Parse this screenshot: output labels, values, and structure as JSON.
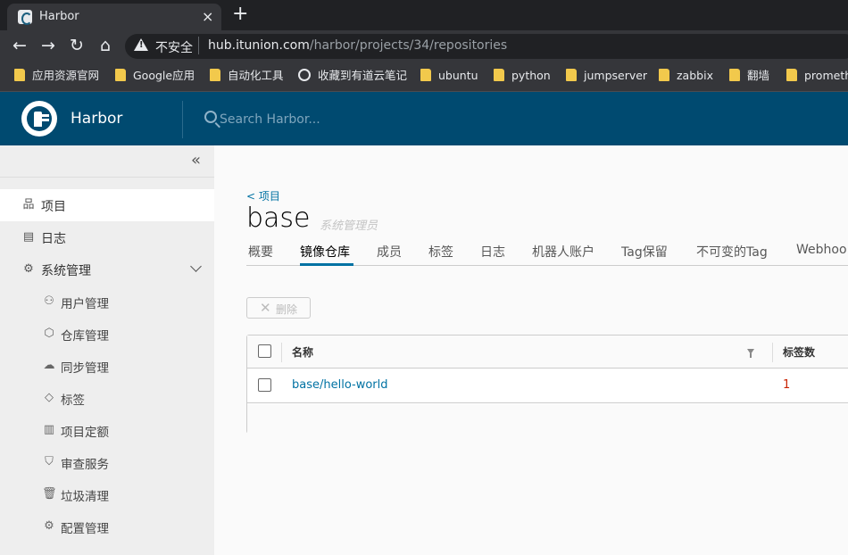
{
  "browser": {
    "tab_title": "Harbor",
    "close_glyph": "×",
    "new_tab_glyph": "+",
    "insecure_label": "不安全",
    "url_host": "hub.itunion.com",
    "url_path": "/harbor/projects/34/repositories",
    "back_glyph": "←",
    "forward_glyph": "→",
    "reload_glyph": "↻",
    "home_glyph": "⌂",
    "bookmarks": [
      {
        "label": "应用资源官网",
        "icon": "folder-icon"
      },
      {
        "label": "Google应用",
        "icon": "folder-icon"
      },
      {
        "label": "自动化工具",
        "icon": "folder-icon"
      },
      {
        "label": "收藏到有道云笔记",
        "icon": "globe-icon"
      },
      {
        "label": "ubuntu",
        "icon": "folder-icon"
      },
      {
        "label": "python",
        "icon": "folder-icon"
      },
      {
        "label": "jumpserver",
        "icon": "folder-icon"
      },
      {
        "label": "zabbix",
        "icon": "folder-icon"
      },
      {
        "label": "翻墙",
        "icon": "folder-icon"
      },
      {
        "label": "prometh",
        "icon": "folder-icon"
      }
    ]
  },
  "header": {
    "brand": "Harbor",
    "search_placeholder": "Search Harbor..."
  },
  "sidebar": {
    "collapse_glyph": "«",
    "items": [
      {
        "label": "项目",
        "icon": "projects-icon",
        "glyph": "品",
        "active": true
      },
      {
        "label": "日志",
        "icon": "logs-icon",
        "glyph": "▤",
        "active": false
      },
      {
        "label": "系统管理",
        "icon": "admin-icon",
        "glyph": "⚙",
        "active": false
      }
    ],
    "sub_items": [
      {
        "label": "用户管理",
        "icon": "users-icon",
        "glyph": "⚇"
      },
      {
        "label": "仓库管理",
        "icon": "registry-icon",
        "glyph": "⬡"
      },
      {
        "label": "同步管理",
        "icon": "replication-icon",
        "glyph": "☁"
      },
      {
        "label": "标签",
        "icon": "tag-icon",
        "glyph": "◇"
      },
      {
        "label": "项目定额",
        "icon": "quota-icon",
        "glyph": "▥"
      },
      {
        "label": "审查服务",
        "icon": "shield-icon",
        "glyph": "⛉"
      },
      {
        "label": "垃圾清理",
        "icon": "trash-icon",
        "glyph": "🗑"
      },
      {
        "label": "配置管理",
        "icon": "gear-icon",
        "glyph": "⚙"
      }
    ]
  },
  "main": {
    "breadcrumb": "< 项目",
    "title": "base",
    "role": "系统管理员",
    "tabs": [
      "概要",
      "镜像仓库",
      "成员",
      "标签",
      "日志",
      "机器人账户",
      "Tag保留",
      "不可变的Tag",
      "Webhoo"
    ],
    "active_tab": 1,
    "delete_label": "删除",
    "delete_glyph": "✕",
    "table": {
      "columns": [
        "名称",
        "标签数"
      ],
      "rows": [
        {
          "name": "base/hello-world",
          "tags": "1"
        }
      ]
    }
  },
  "colors": {
    "header_bg": "#004a70",
    "accent": "#0072a3",
    "count_red": "#c92100"
  }
}
